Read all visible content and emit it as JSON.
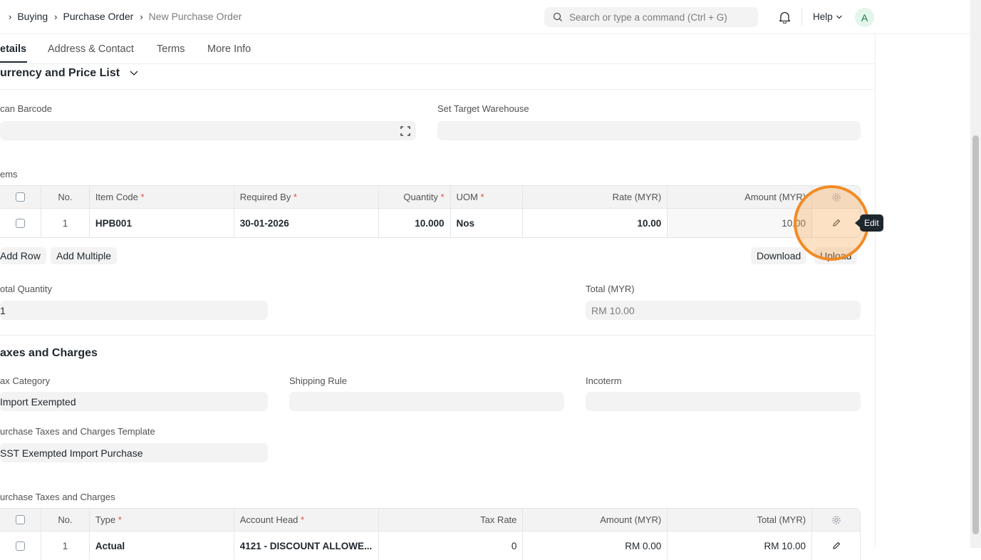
{
  "navbar": {
    "breadcrumbs": [
      "Buying",
      "Purchase Order",
      "New Purchase Order"
    ],
    "search_placeholder": "Search or type a command (Ctrl + G)",
    "help_label": "Help",
    "avatar_initial": "A"
  },
  "tabs": [
    "etails",
    "Address & Contact",
    "Terms",
    "More Info"
  ],
  "currency_section": {
    "title": "urrency and Price List",
    "scan_barcode_label": "can Barcode",
    "set_target_warehouse_label": "Set Target Warehouse"
  },
  "items": {
    "label": "ems",
    "columns": [
      "No.",
      "Item Code",
      "Required By",
      "Quantity",
      "UOM",
      "Rate (MYR)",
      "Amount (MYR)"
    ],
    "rows": [
      {
        "no": "1",
        "item_code": "HPB001",
        "required_by": "30-01-2026",
        "quantity": "10.000",
        "uom": "Nos",
        "rate": "10.00",
        "amount": "10.00"
      }
    ],
    "add_row_label": "Add Row",
    "add_multiple_label": "Add Multiple",
    "download_label": "Download",
    "upload_label": "Upload",
    "edit_tooltip": "Edit"
  },
  "totals": {
    "total_quantity_label": "otal Quantity",
    "total_quantity_value": "1",
    "total_label": "Total (MYR)",
    "total_value": "RM 10.00"
  },
  "taxes_section": {
    "title": "axes and Charges",
    "tax_category_label": "ax Category",
    "tax_category_value": "Import Exempted",
    "shipping_rule_label": "Shipping Rule",
    "incoterm_label": "Incoterm",
    "template_label": "urchase Taxes and Charges Template",
    "template_value": "SST Exempted Import Purchase",
    "table_label": "urchase Taxes and Charges",
    "columns": [
      "No.",
      "Type",
      "Account Head",
      "Tax Rate",
      "Amount (MYR)",
      "Total (MYR)"
    ],
    "rows": [
      {
        "no": "1",
        "type": "Actual",
        "account_head": "4121 - DISCOUNT ALLOWE...",
        "tax_rate": "0",
        "amount": "RM 0.00",
        "total": "RM 10.00"
      }
    ]
  },
  "colors": {
    "accent_ring": "#f28b25",
    "required": "#e24c4c"
  }
}
